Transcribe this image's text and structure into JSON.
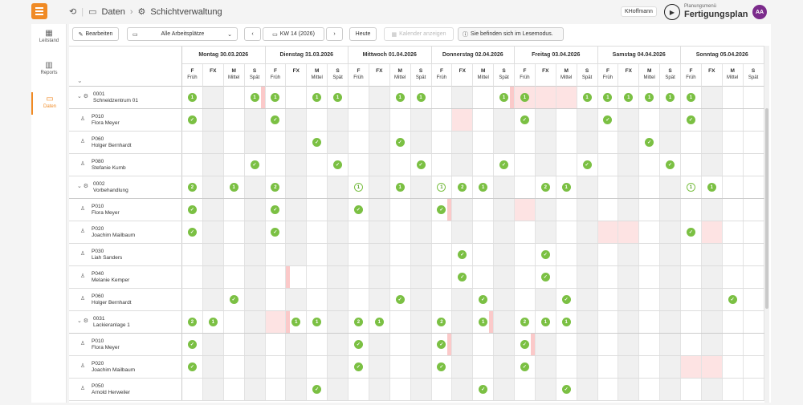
{
  "app": {
    "breadcrumb_root": "Daten",
    "breadcrumb_page": "Schichtverwaltung",
    "user": "KHoffmann",
    "plan_menu_label": "Planungsmenü",
    "plan_title": "Fertigungsplan",
    "avatar_initials": "AA",
    "accent_color": "#f08a24",
    "avatar_color": "#7b2b8b"
  },
  "sidebar": {
    "items": [
      {
        "label": "Leitstand",
        "icon": "dashboard-icon"
      },
      {
        "label": "Reports",
        "icon": "chart-icon"
      },
      {
        "label": "Daten",
        "icon": "folder-icon",
        "active": true
      }
    ]
  },
  "toolbar": {
    "edit_label": "Bearbeiten",
    "workplace_select": "Alle Arbeitsplätze",
    "week": "KW 14 (2026)",
    "today": "Heute",
    "calendar_button": "Kalender anzeigen",
    "readonly_notice": "Sie befinden sich im Lesemodus."
  },
  "days": [
    "Montag 30.03.2026",
    "Dienstag 31.03.2026",
    "Mittwoch 01.04.2026",
    "Donnerstag 02.04.2026",
    "Freitag 03.04.2026",
    "Samstag 04.04.2026",
    "Sonntag 05.04.2026"
  ],
  "shifts": [
    {
      "code": "F",
      "name": "Früh"
    },
    {
      "code": "FX",
      "name": ""
    },
    {
      "code": "M",
      "name": "Mittel"
    },
    {
      "code": "S",
      "name": "Spät"
    }
  ],
  "status_colors": {
    "assigned": "#7bc043",
    "unavailable": "#fde3e3",
    "blocked": "#f0f0f0"
  },
  "rows": [
    {
      "type": "group",
      "code": "0001",
      "name": "Schneidzentrum 01",
      "cells": [
        "1",
        "G",
        "",
        "1|",
        "1",
        "",
        "1",
        "1",
        "",
        "G",
        "1",
        "1",
        "",
        "G",
        "",
        "1|",
        "P|1",
        "P",
        "P",
        "1",
        "1",
        "1",
        "1",
        "1",
        "1",
        "G",
        "",
        ""
      ]
    },
    {
      "type": "person",
      "code": "P010",
      "name": "Flora Meyer",
      "cells": [
        "C",
        "G",
        "",
        "G",
        "C",
        "G",
        "",
        "G",
        "",
        "G",
        "",
        "G",
        "",
        "P",
        "",
        "G",
        "C",
        "G",
        "",
        "G",
        "C",
        "G",
        "",
        "G",
        "C",
        "G",
        "",
        ""
      ]
    },
    {
      "type": "person",
      "code": "P060",
      "name": "Holger Bernhardt",
      "cells": [
        "",
        "G",
        "",
        "G",
        "",
        "G",
        "C",
        "G",
        "",
        "G",
        "C",
        "G",
        "",
        "G",
        "",
        "G",
        "",
        "G",
        "",
        "G",
        "",
        "G",
        "C",
        "G",
        "",
        "G",
        "",
        ""
      ]
    },
    {
      "type": "person",
      "code": "P080",
      "name": "Stefanie Kumb",
      "cells": [
        "",
        "G",
        "",
        "C",
        "",
        "G",
        "",
        "C",
        "",
        "G",
        "",
        "C",
        "",
        "G",
        "",
        "C",
        "",
        "G",
        "",
        "C",
        "",
        "G",
        "",
        "C",
        "",
        "G",
        "",
        ""
      ]
    },
    {
      "type": "group",
      "code": "0002",
      "name": "Vorbehandlung",
      "cells": [
        "2",
        "G",
        "1",
        "G",
        "2",
        "G",
        "",
        "G",
        "o1",
        "G",
        "1",
        "G",
        "o1",
        "2",
        "1",
        "G",
        "",
        "2",
        "1",
        "G",
        "",
        "G",
        "",
        "G",
        "o1",
        "1",
        "",
        ""
      ]
    },
    {
      "type": "person",
      "code": "P010",
      "name": "Flora Meyer",
      "cells": [
        "C",
        "G",
        "",
        "G",
        "C",
        "G",
        "",
        "G",
        "C",
        "G",
        "",
        "G",
        "C|",
        "G",
        "",
        "G",
        "P",
        "G",
        "",
        "G",
        "",
        "G",
        "",
        "G",
        "",
        "G",
        "",
        ""
      ]
    },
    {
      "type": "person",
      "code": "P020",
      "name": "Joachim Mailbaum",
      "cells": [
        "C",
        "G",
        "",
        "G",
        "C",
        "G",
        "",
        "G",
        "",
        "G",
        "",
        "G",
        "",
        "G",
        "",
        "G",
        "",
        "G",
        "",
        "G",
        "P",
        "P",
        "",
        "G",
        "C",
        "P",
        "",
        ""
      ]
    },
    {
      "type": "person",
      "code": "P030",
      "name": "Liah Sanders",
      "cells": [
        "",
        "G",
        "",
        "G",
        "",
        "G",
        "",
        "G",
        "",
        "G",
        "",
        "G",
        "",
        "C",
        "",
        "G",
        "",
        "C",
        "",
        "G",
        "",
        "G",
        "",
        "G",
        "",
        "G",
        "",
        ""
      ]
    },
    {
      "type": "person",
      "code": "P040",
      "name": "Melanie Kemper",
      "cells": [
        "",
        "G",
        "",
        "G",
        "",
        "|",
        "",
        "G",
        "",
        "G",
        "",
        "G",
        "",
        "C",
        "",
        "G",
        "",
        "C",
        "",
        "G",
        "",
        "G",
        "",
        "G",
        "",
        "G",
        "",
        ""
      ]
    },
    {
      "type": "person",
      "code": "P060",
      "name": "Holger Bernhardt",
      "cells": [
        "",
        "G",
        "C",
        "G",
        "",
        "G",
        "",
        "G",
        "",
        "G",
        "C",
        "G",
        "",
        "G",
        "C",
        "G",
        "",
        "G",
        "C",
        "G",
        "",
        "G",
        "",
        "G",
        "",
        "G",
        "C",
        ""
      ]
    },
    {
      "type": "group",
      "code": "0031",
      "name": "Lackieranlage 1",
      "cells": [
        "2",
        "1",
        "",
        "G",
        "P",
        "|1",
        "1",
        "G",
        "2",
        "1",
        "",
        "G",
        "2",
        "G",
        "1|",
        "G",
        "2",
        "1",
        "1",
        "G",
        "",
        "G",
        "",
        "G",
        "",
        "G",
        "",
        ""
      ]
    },
    {
      "type": "person",
      "code": "P010",
      "name": "Flora Meyer",
      "cells": [
        "C",
        "G",
        "",
        "G",
        "",
        "G",
        "",
        "G",
        "C",
        "G",
        "",
        "G",
        "C|",
        "G",
        "",
        "G",
        "C|",
        "G",
        "",
        "G",
        "",
        "G",
        "",
        "G",
        "",
        "G",
        "",
        ""
      ]
    },
    {
      "type": "person",
      "code": "P020",
      "name": "Joachim Mailbaum",
      "cells": [
        "C",
        "G",
        "",
        "G",
        "",
        "G",
        "",
        "G",
        "C",
        "G",
        "",
        "G",
        "C",
        "G",
        "",
        "G",
        "C",
        "G",
        "",
        "G",
        "",
        "G",
        "",
        "G",
        "P",
        "P",
        "",
        ""
      ]
    },
    {
      "type": "person",
      "code": "P050",
      "name": "Arnold Herweiler",
      "cells": [
        "",
        "G",
        "",
        "G",
        "",
        "G",
        "C",
        "G",
        "",
        "G",
        "",
        "G",
        "",
        "G",
        "C",
        "G",
        "",
        "G",
        "C",
        "G",
        "",
        "G",
        "",
        "G",
        "",
        "G",
        "",
        ""
      ]
    }
  ]
}
